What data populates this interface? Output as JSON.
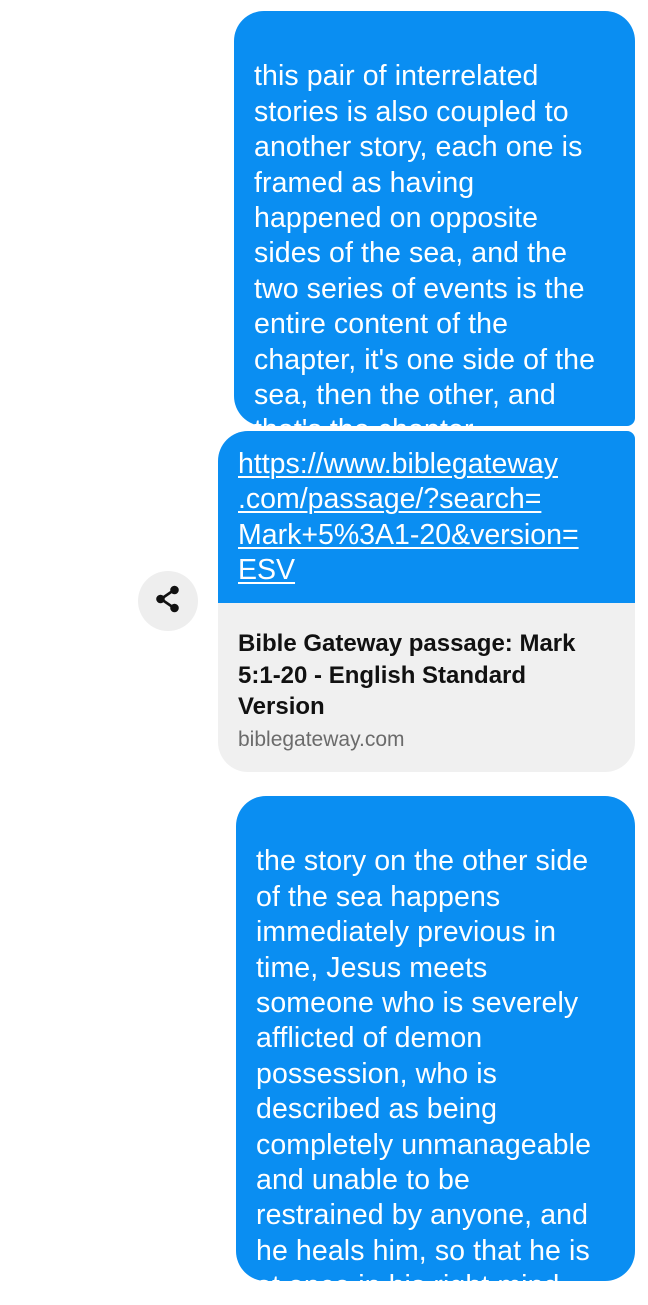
{
  "messages": [
    {
      "text": "this pair of interrelated\nstories is also coupled to\nanother story, each one is\nframed as having\nhappened on opposite\nsides of the sea, and the\ntwo series of events is the\nentire content of the\nchapter, it's one side of the\nsea, then the other, and\nthat's the chapter"
    },
    {
      "text": "the story on the other side\nof the sea happens\nimmediately previous in\ntime, Jesus meets\nsomeone who is severely\nafflicted of demon\npossession, who is\ndescribed as being\ncompletely unmanageable\nand unable to be\nrestrained by anyone, and\nhe heals him, so that he is\nat once in his right mind"
    }
  ],
  "link_message": {
    "url": "https://www.biblegateway\n.com/passage/?search=\nMark+5%3A1-20&version=\nESV",
    "preview_title": "Bible Gateway passage: Mark\n5:1-20 - English Standard\nVersion",
    "preview_domain": "biblegateway.com"
  },
  "share": {
    "icon": "share-icon"
  },
  "colors": {
    "bubble": "#0a8ef2",
    "preview_bg": "#f0f0f0",
    "share_bg": "#eeeeee"
  }
}
